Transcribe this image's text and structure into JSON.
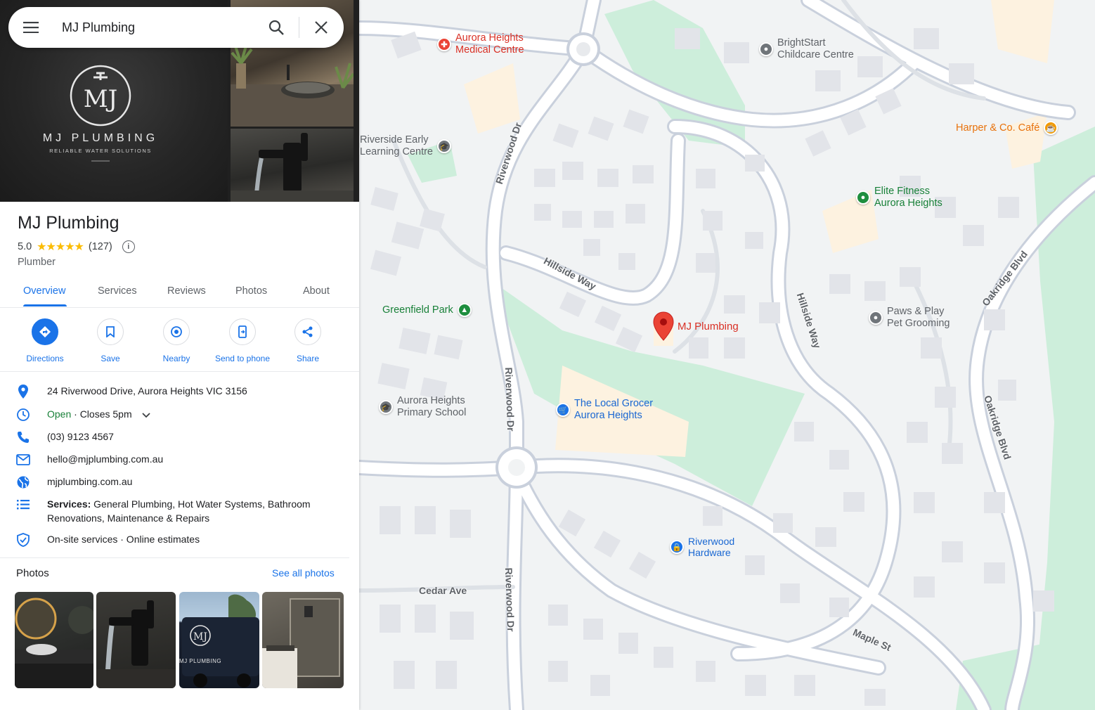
{
  "search": {
    "value": "MJ Plumbing"
  },
  "hero": {
    "logo_title": "MJ PLUMBING",
    "logo_tagline": "RELIABLE WATER SOLUTIONS",
    "logo_monogram": "MJ"
  },
  "business": {
    "name": "MJ Plumbing",
    "rating": "5.0",
    "stars": "★★★★★",
    "review_count": "(127)",
    "category": "Plumber"
  },
  "tabs": [
    {
      "label": "Overview",
      "active": true
    },
    {
      "label": "Services"
    },
    {
      "label": "Reviews"
    },
    {
      "label": "Photos"
    },
    {
      "label": "About"
    }
  ],
  "actions": [
    {
      "label": "Directions",
      "icon": "directions-icon"
    },
    {
      "label": "Save",
      "icon": "bookmark-icon"
    },
    {
      "label": "Nearby",
      "icon": "nearby-icon"
    },
    {
      "label": "Send to phone",
      "icon": "send-to-phone-icon"
    },
    {
      "label": "Share",
      "icon": "share-icon"
    }
  ],
  "details": {
    "address": "24 Riverwood Drive, Aurora Heights VIC 3156",
    "hours_status": "Open",
    "hours_closes": " · Closes 5pm",
    "phone": "(03) 9123 4567",
    "email": "hello@mjplumbing.com.au",
    "website": "mjplumbing.com.au",
    "services_label": "Services:",
    "services_line1": " General Plumbing, Hot Water Systems, Bathroom",
    "services_line2": "Renovations, Maintenance & Repairs",
    "highlights": "On-site services · Online estimates"
  },
  "photos": {
    "title": "Photos",
    "see_all": "See all photos"
  },
  "map": {
    "pin_label": "MJ Plumbing",
    "places": {
      "aurora_medical_1": "Aurora Heights",
      "aurora_medical_2": "Medical Centre",
      "brightstart_1": "BrightStart",
      "brightstart_2": "Childcare Centre",
      "harper": "Harper & Co. Café",
      "riverside_1": "Riverside Early",
      "riverside_2": "Learning Centre",
      "elite_1": "Elite Fitness",
      "elite_2": "Aurora Heights",
      "greenfield": "Greenfield Park",
      "paws_1": "Paws & Play",
      "paws_2": "Pet Grooming",
      "school_1": "Aurora Heights",
      "school_2": "Primary School",
      "grocer_1": "The Local Grocer",
      "grocer_2": "Aurora Heights",
      "hardware_1": "Riverwood",
      "hardware_2": "Hardware"
    },
    "roads": {
      "riverwood_top": "Riverwood Dr",
      "riverwood_mid": "Riverwood Dr",
      "riverwood_bot": "Riverwood Dr",
      "hillside_w": "Hillside Way",
      "hillside_e": "Hillside Way",
      "oakridge_top": "Oakridge Blvd",
      "oakridge_mid": "Oakridge Blvd",
      "cedar": "Cedar Ave",
      "maple": "Maple St"
    },
    "colors": {
      "park": "#cdeedb",
      "commercial": "#fdf2e0",
      "road": "#ffffff",
      "road_edge": "#c9d0dc",
      "building": "#e8e9ed",
      "pin": "#ea4335"
    }
  }
}
